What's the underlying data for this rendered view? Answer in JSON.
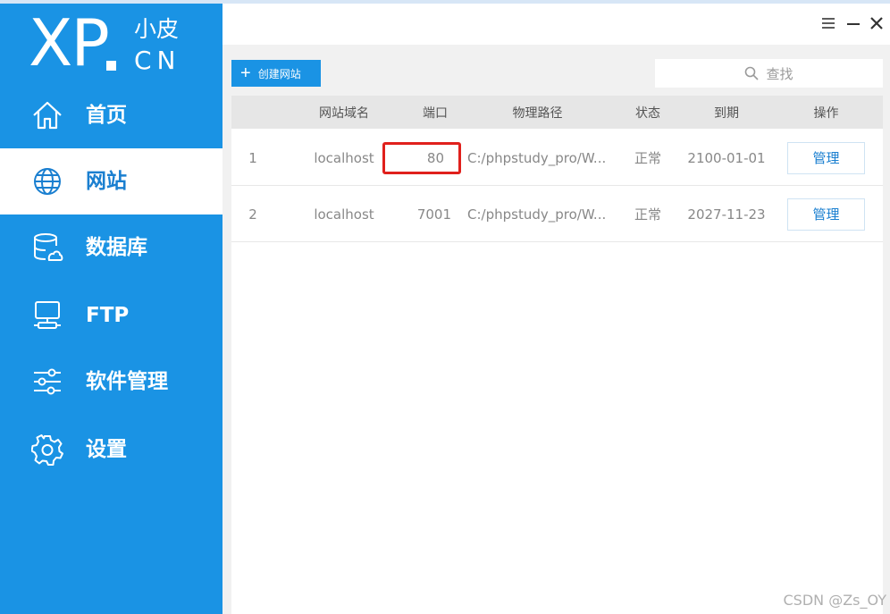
{
  "logo": {
    "brand": "XP",
    "cn_top": "小皮",
    "cn_bottom": "CN"
  },
  "sidebar": {
    "items": [
      {
        "label": "首页",
        "icon": "home-icon",
        "active": false
      },
      {
        "label": "网站",
        "icon": "globe-icon",
        "active": true
      },
      {
        "label": "数据库",
        "icon": "database-icon",
        "active": false
      },
      {
        "label": "FTP",
        "icon": "ftp-icon",
        "active": false
      },
      {
        "label": "软件管理",
        "icon": "sliders-icon",
        "active": false
      },
      {
        "label": "设置",
        "icon": "gear-icon",
        "active": false
      }
    ]
  },
  "toolbar": {
    "create_label": "创建网站",
    "search_placeholder": "查找"
  },
  "table": {
    "headers": [
      "网站域名",
      "端口",
      "物理路径",
      "状态",
      "到期",
      "操作"
    ],
    "rows": [
      {
        "index": "1",
        "domain": "localhost",
        "port": "80",
        "path": "C:/phpstudy_pro/W...",
        "status": "正常",
        "expiry": "2100-01-01",
        "action": "管理"
      },
      {
        "index": "2",
        "domain": "localhost",
        "port": "7001",
        "path": "C:/phpstudy_pro/W...",
        "status": "正常",
        "expiry": "2027-11-23",
        "action": "管理"
      }
    ]
  },
  "watermark": "CSDN @Zs_OY",
  "colors": {
    "accent": "#1a93e4",
    "highlight": "#e0201c"
  }
}
